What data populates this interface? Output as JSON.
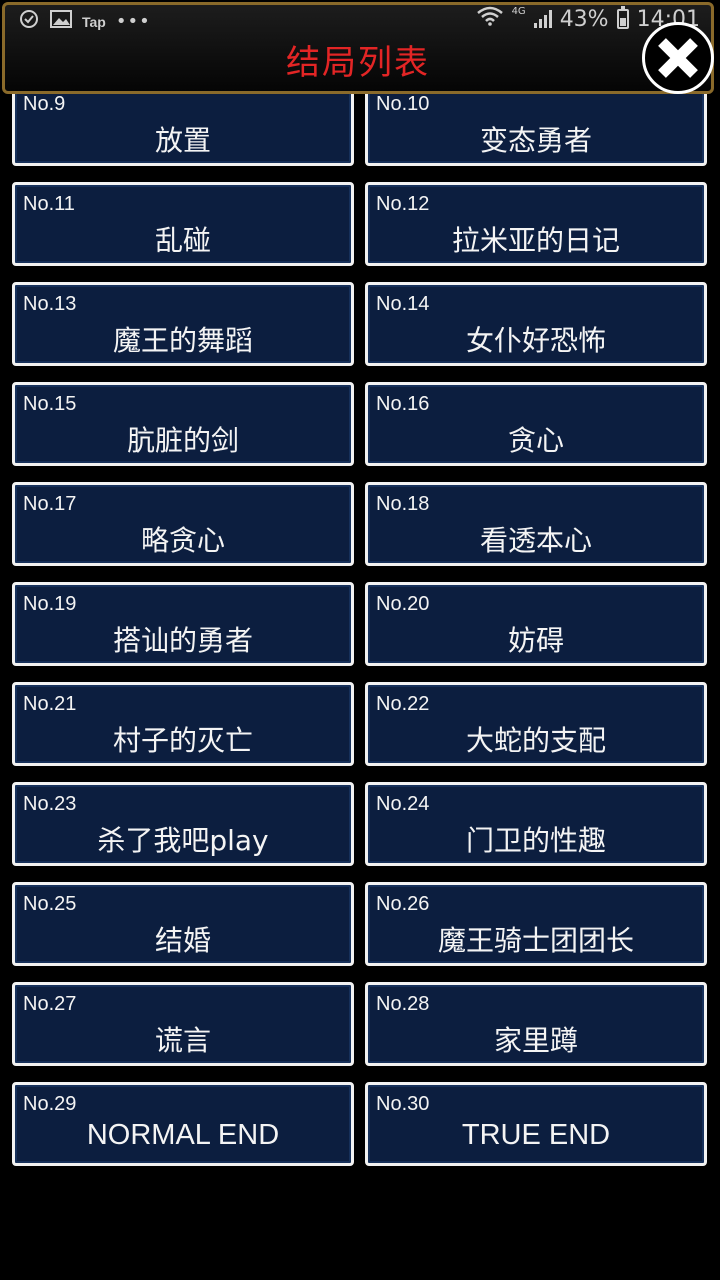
{
  "status_bar": {
    "app_label": "Tap",
    "more": "•••",
    "network": "4G",
    "battery": "43%",
    "time": "14:01"
  },
  "header": {
    "title": "结局列表"
  },
  "endings": [
    {
      "number": "No.9",
      "title": "放置"
    },
    {
      "number": "No.10",
      "title": "变态勇者"
    },
    {
      "number": "No.11",
      "title": "乱碰"
    },
    {
      "number": "No.12",
      "title": "拉米亚的日记"
    },
    {
      "number": "No.13",
      "title": "魔王的舞蹈"
    },
    {
      "number": "No.14",
      "title": "女仆好恐怖"
    },
    {
      "number": "No.15",
      "title": "肮脏的剑"
    },
    {
      "number": "No.16",
      "title": "贪心"
    },
    {
      "number": "No.17",
      "title": "略贪心"
    },
    {
      "number": "No.18",
      "title": "看透本心"
    },
    {
      "number": "No.19",
      "title": "搭讪的勇者"
    },
    {
      "number": "No.20",
      "title": "妨碍"
    },
    {
      "number": "No.21",
      "title": "村子的灭亡"
    },
    {
      "number": "No.22",
      "title": "大蛇的支配"
    },
    {
      "number": "No.23",
      "title": "杀了我吧play"
    },
    {
      "number": "No.24",
      "title": "门卫的性趣"
    },
    {
      "number": "No.25",
      "title": "结婚"
    },
    {
      "number": "No.26",
      "title": "魔王骑士团团长"
    },
    {
      "number": "No.27",
      "title": "谎言"
    },
    {
      "number": "No.28",
      "title": "家里蹲"
    },
    {
      "number": "No.29",
      "title": "NORMAL END"
    },
    {
      "number": "No.30",
      "title": "TRUE END"
    }
  ],
  "colors": {
    "title_red": "#e32525",
    "card_bg": "#0c1e3f",
    "card_border": "#f2f2f2",
    "header_border": "#8a6a2a"
  },
  "icons": [
    "close-icon",
    "wifi-icon",
    "signal-icon",
    "battery-icon",
    "image-icon",
    "notification-icon"
  ]
}
